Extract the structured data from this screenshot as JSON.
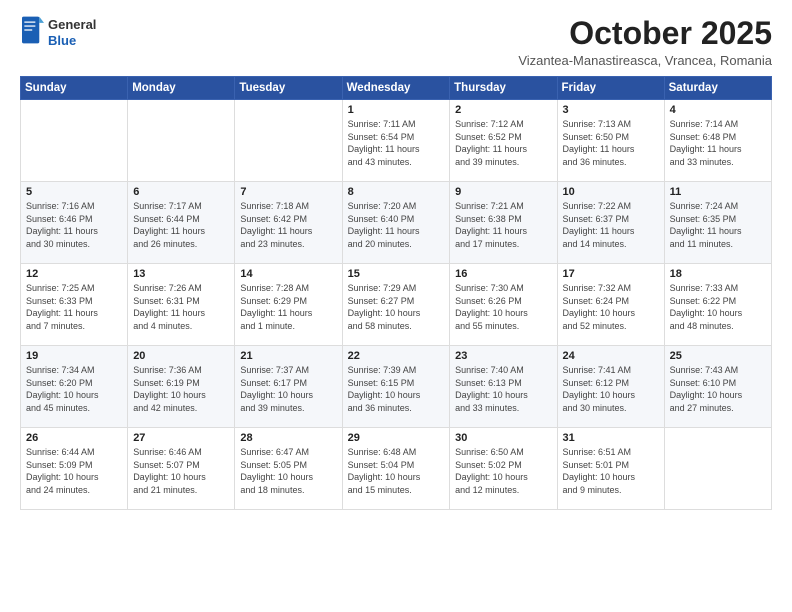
{
  "logo": {
    "general": "General",
    "blue": "Blue"
  },
  "header": {
    "month": "October 2025",
    "subtitle": "Vizantea-Manastireasca, Vrancea, Romania"
  },
  "days_of_week": [
    "Sunday",
    "Monday",
    "Tuesday",
    "Wednesday",
    "Thursday",
    "Friday",
    "Saturday"
  ],
  "weeks": [
    [
      {
        "day": "",
        "info": ""
      },
      {
        "day": "",
        "info": ""
      },
      {
        "day": "",
        "info": ""
      },
      {
        "day": "1",
        "info": "Sunrise: 7:11 AM\nSunset: 6:54 PM\nDaylight: 11 hours\nand 43 minutes."
      },
      {
        "day": "2",
        "info": "Sunrise: 7:12 AM\nSunset: 6:52 PM\nDaylight: 11 hours\nand 39 minutes."
      },
      {
        "day": "3",
        "info": "Sunrise: 7:13 AM\nSunset: 6:50 PM\nDaylight: 11 hours\nand 36 minutes."
      },
      {
        "day": "4",
        "info": "Sunrise: 7:14 AM\nSunset: 6:48 PM\nDaylight: 11 hours\nand 33 minutes."
      }
    ],
    [
      {
        "day": "5",
        "info": "Sunrise: 7:16 AM\nSunset: 6:46 PM\nDaylight: 11 hours\nand 30 minutes."
      },
      {
        "day": "6",
        "info": "Sunrise: 7:17 AM\nSunset: 6:44 PM\nDaylight: 11 hours\nand 26 minutes."
      },
      {
        "day": "7",
        "info": "Sunrise: 7:18 AM\nSunset: 6:42 PM\nDaylight: 11 hours\nand 23 minutes."
      },
      {
        "day": "8",
        "info": "Sunrise: 7:20 AM\nSunset: 6:40 PM\nDaylight: 11 hours\nand 20 minutes."
      },
      {
        "day": "9",
        "info": "Sunrise: 7:21 AM\nSunset: 6:38 PM\nDaylight: 11 hours\nand 17 minutes."
      },
      {
        "day": "10",
        "info": "Sunrise: 7:22 AM\nSunset: 6:37 PM\nDaylight: 11 hours\nand 14 minutes."
      },
      {
        "day": "11",
        "info": "Sunrise: 7:24 AM\nSunset: 6:35 PM\nDaylight: 11 hours\nand 11 minutes."
      }
    ],
    [
      {
        "day": "12",
        "info": "Sunrise: 7:25 AM\nSunset: 6:33 PM\nDaylight: 11 hours\nand 7 minutes."
      },
      {
        "day": "13",
        "info": "Sunrise: 7:26 AM\nSunset: 6:31 PM\nDaylight: 11 hours\nand 4 minutes."
      },
      {
        "day": "14",
        "info": "Sunrise: 7:28 AM\nSunset: 6:29 PM\nDaylight: 11 hours\nand 1 minute."
      },
      {
        "day": "15",
        "info": "Sunrise: 7:29 AM\nSunset: 6:27 PM\nDaylight: 10 hours\nand 58 minutes."
      },
      {
        "day": "16",
        "info": "Sunrise: 7:30 AM\nSunset: 6:26 PM\nDaylight: 10 hours\nand 55 minutes."
      },
      {
        "day": "17",
        "info": "Sunrise: 7:32 AM\nSunset: 6:24 PM\nDaylight: 10 hours\nand 52 minutes."
      },
      {
        "day": "18",
        "info": "Sunrise: 7:33 AM\nSunset: 6:22 PM\nDaylight: 10 hours\nand 48 minutes."
      }
    ],
    [
      {
        "day": "19",
        "info": "Sunrise: 7:34 AM\nSunset: 6:20 PM\nDaylight: 10 hours\nand 45 minutes."
      },
      {
        "day": "20",
        "info": "Sunrise: 7:36 AM\nSunset: 6:19 PM\nDaylight: 10 hours\nand 42 minutes."
      },
      {
        "day": "21",
        "info": "Sunrise: 7:37 AM\nSunset: 6:17 PM\nDaylight: 10 hours\nand 39 minutes."
      },
      {
        "day": "22",
        "info": "Sunrise: 7:39 AM\nSunset: 6:15 PM\nDaylight: 10 hours\nand 36 minutes."
      },
      {
        "day": "23",
        "info": "Sunrise: 7:40 AM\nSunset: 6:13 PM\nDaylight: 10 hours\nand 33 minutes."
      },
      {
        "day": "24",
        "info": "Sunrise: 7:41 AM\nSunset: 6:12 PM\nDaylight: 10 hours\nand 30 minutes."
      },
      {
        "day": "25",
        "info": "Sunrise: 7:43 AM\nSunset: 6:10 PM\nDaylight: 10 hours\nand 27 minutes."
      }
    ],
    [
      {
        "day": "26",
        "info": "Sunrise: 6:44 AM\nSunset: 5:09 PM\nDaylight: 10 hours\nand 24 minutes."
      },
      {
        "day": "27",
        "info": "Sunrise: 6:46 AM\nSunset: 5:07 PM\nDaylight: 10 hours\nand 21 minutes."
      },
      {
        "day": "28",
        "info": "Sunrise: 6:47 AM\nSunset: 5:05 PM\nDaylight: 10 hours\nand 18 minutes."
      },
      {
        "day": "29",
        "info": "Sunrise: 6:48 AM\nSunset: 5:04 PM\nDaylight: 10 hours\nand 15 minutes."
      },
      {
        "day": "30",
        "info": "Sunrise: 6:50 AM\nSunset: 5:02 PM\nDaylight: 10 hours\nand 12 minutes."
      },
      {
        "day": "31",
        "info": "Sunrise: 6:51 AM\nSunset: 5:01 PM\nDaylight: 10 hours\nand 9 minutes."
      },
      {
        "day": "",
        "info": ""
      }
    ]
  ]
}
